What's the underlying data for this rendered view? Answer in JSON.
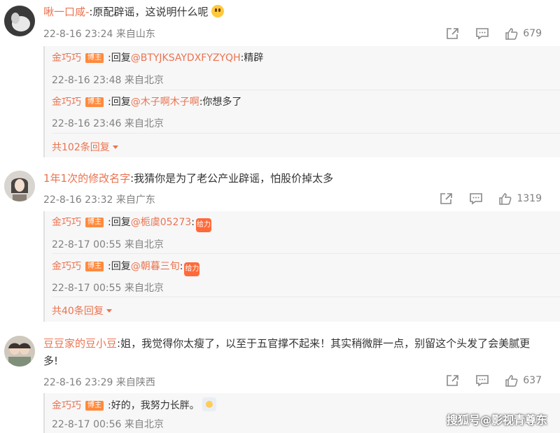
{
  "comments": [
    {
      "username": "啾一口咸-",
      "text": ":原配辟谣，这说明什么呢",
      "meta": "22-8-16 23:24 来自山东",
      "likes": "679",
      "replies": [
        {
          "username": "金巧巧",
          "badge": "博主",
          "prefix": ":回复",
          "mention": "@BTYJKSAYDXFYZYQH",
          "text": ":精辟",
          "meta": "22-8-16 23:48 来自北京"
        },
        {
          "username": "金巧巧",
          "badge": "博主",
          "prefix": ":回复",
          "mention": "@木子啊木子啊",
          "text": ":你想多了",
          "meta": "22-8-16 23:46 来自北京"
        }
      ],
      "more": "共102条回复"
    },
    {
      "username": "1年1次的修改名字",
      "text": ":我猜你是为了老公产业辟谣，怕股价掉太多",
      "meta": "22-8-16 23:32 来自广东",
      "likes": "1319",
      "replies": [
        {
          "username": "金巧巧",
          "badge": "博主",
          "prefix": ":回复",
          "mention": "@栀虞05273",
          "text": ":",
          "meta": "22-8-17 00:55 来自北京"
        },
        {
          "username": "金巧巧",
          "badge": "博主",
          "prefix": ":回复",
          "mention": "@朝暮三旬",
          "text": ":",
          "meta": "22-8-17 00:55 来自北京"
        }
      ],
      "more": "共40条回复"
    },
    {
      "username": "豆豆家的豆小豆",
      "text": ":姐，我觉得你太瘦了，以至于五官撑不起来！其实稍微胖一点，别留这个头发了会美腻更",
      "text2": "多!",
      "meta": "22-8-16 23:29 来自陕西",
      "likes": "637",
      "replies": [
        {
          "username": "金巧巧",
          "badge": "博主",
          "text": ":好的，我努力长胖。",
          "meta": "22-8-17 00:56 来自北京"
        }
      ]
    }
  ],
  "sticker_text": "给力",
  "watermark": "搜狐号@影视青尊东",
  "icons": [
    "share-icon",
    "comment-icon",
    "like-icon"
  ],
  "colors": {
    "username": "#eb7350",
    "meta": "#808080",
    "badge": "#ff8a3d",
    "reply_bg": "#f7f7f7"
  }
}
